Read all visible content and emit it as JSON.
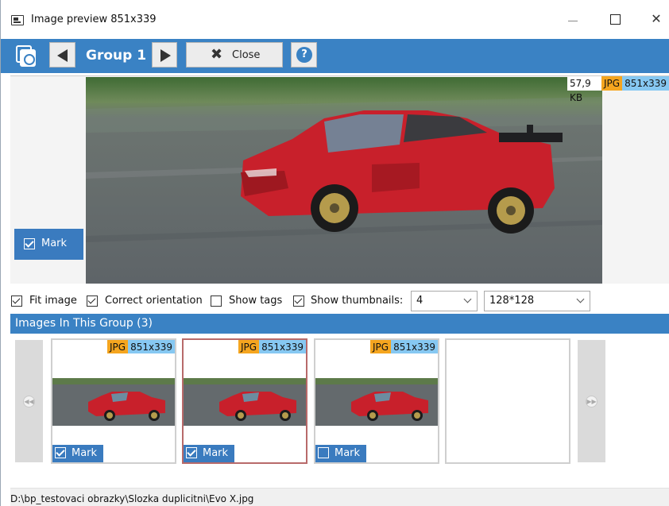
{
  "window": {
    "title": "Image preview 851x339",
    "close_glyph": "✕"
  },
  "toolbar": {
    "group_label": "Group 1",
    "close_label": "Close",
    "close_glyph": "✖",
    "help_glyph": "?"
  },
  "preview": {
    "file_size": "57,9 KB",
    "format": "JPG",
    "dimensions": "851x339",
    "mark_label": "Mark",
    "marked": true
  },
  "options": {
    "fit_image": {
      "label": "Fit image",
      "checked": true
    },
    "correct_orientation": {
      "label": "Correct orientation",
      "checked": true
    },
    "show_tags": {
      "label": "Show tags",
      "checked": false
    },
    "show_thumbnails": {
      "label": "Show thumbnails:",
      "checked": true
    },
    "thumb_count": "4",
    "thumb_size": "128*128"
  },
  "group": {
    "header": "Images In This Group (3)",
    "thumbnails": [
      {
        "format": "JPG",
        "dimensions": "851x339",
        "mark_label": "Mark",
        "marked": true,
        "selected": false
      },
      {
        "format": "JPG",
        "dimensions": "851x339",
        "mark_label": "Mark",
        "marked": true,
        "selected": true
      },
      {
        "format": "JPG",
        "dimensions": "851x339",
        "mark_label": "Mark",
        "marked": false,
        "selected": false
      }
    ]
  },
  "nav": {
    "prev_glyph": "◀◀",
    "next_glyph": "▶▶"
  },
  "status": {
    "path": "D:\\bp_testovaci obrazky\\Slozka duplicitni\\Evo X.jpg"
  },
  "colors": {
    "accent": "#3a82c4",
    "jpg_badge": "#f5a51f",
    "dim_badge": "#86c8f2",
    "selected_border": "#b86a6a"
  }
}
